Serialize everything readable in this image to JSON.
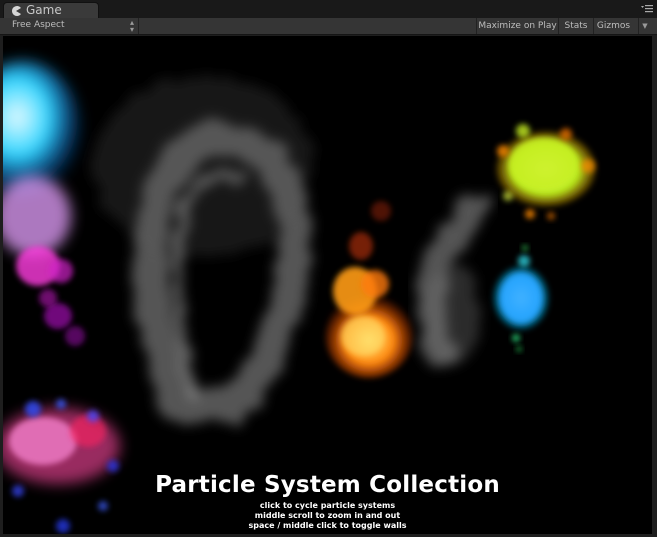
{
  "tab": {
    "label": "Game",
    "icon": "pacman-game-icon"
  },
  "toolbar": {
    "aspect": "Free Aspect",
    "maximize_on_play": "Maximize on Play",
    "stats": "Stats",
    "gizmos": "Gizmos"
  },
  "caption": {
    "title": "Particle System Collection",
    "lines": [
      "click to cycle particle systems",
      "middle scroll to zoom in and out",
      "space / middle click to toggle walls"
    ]
  },
  "colors": {
    "viewport_bg": "#000000",
    "cyan": "#22d8ff",
    "magenta": "#ff33dd",
    "fire": "#ff8a10",
    "lime": "#c8f020",
    "blue": "#3aa8ff"
  }
}
